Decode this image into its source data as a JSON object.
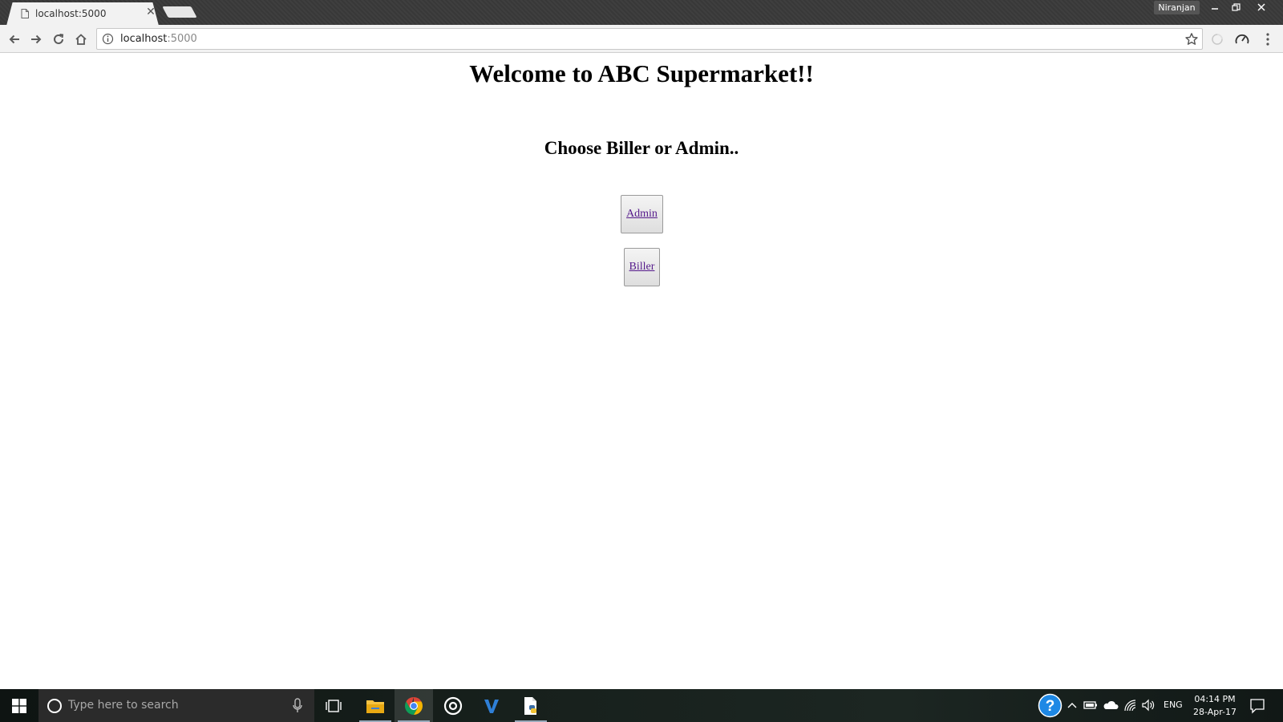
{
  "browser": {
    "tab_title": "localhost:5000",
    "profile_name": "Niranjan",
    "url_host": "localhost",
    "url_port": ":5000"
  },
  "page": {
    "title": "Welcome to ABC Supermarket!!",
    "subtitle": "Choose Biller or Admin..",
    "buttons": {
      "admin": "Admin",
      "biller": "Biller"
    }
  },
  "taskbar": {
    "search_placeholder": "Type here to search",
    "apps": [
      "task-view",
      "file-explorer",
      "google-chrome",
      "groove-music",
      "visual-studio",
      "python"
    ],
    "language": "ENG",
    "time": "04:14 PM",
    "date": "28-Apr-17"
  },
  "colors": {
    "link_visited": "#551a8b",
    "titlebar": "#3a3a3a",
    "toolbar": "#f2f2f2",
    "taskbar": "#17201c",
    "help_blue": "#1e88e5"
  }
}
